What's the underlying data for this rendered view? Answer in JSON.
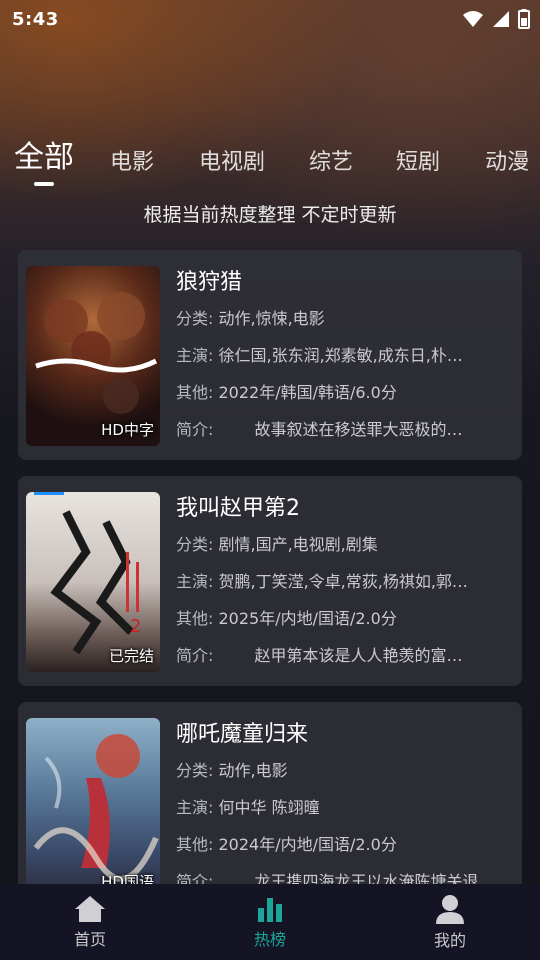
{
  "status_bar": {
    "time": "5:43"
  },
  "tabs": [
    {
      "label": "全部",
      "active": true
    },
    {
      "label": "电影",
      "active": false
    },
    {
      "label": "电视剧",
      "active": false
    },
    {
      "label": "综艺",
      "active": false
    },
    {
      "label": "短剧",
      "active": false
    },
    {
      "label": "动漫",
      "active": false
    }
  ],
  "subtitle": "根据当前热度整理 不定时更新",
  "field_labels": {
    "category": "分类: ",
    "cast": "主演: ",
    "other": "其他: ",
    "intro": "简介: "
  },
  "items": [
    {
      "title": "狼狩猎",
      "badge": "HD中字",
      "category": "动作,惊悚,电影",
      "cast": "徐仁国,张东润,郑素敏,成东日,朴…",
      "other": "2022年/韩国/韩语/6.0分",
      "intro": "故事叙述在移送罪大恶极的…"
    },
    {
      "title": "我叫赵甲第2",
      "badge": "已完结",
      "category": "剧情,国产,电视剧,剧集",
      "cast": "贺鹏,丁笑滢,令卓,常荻,杨祺如,郭…",
      "other": "2025年/内地/国语/2.0分",
      "intro": "赵甲第本该是人人艳羡的富…"
    },
    {
      "title": "哪吒魔童归来",
      "badge": "HD国语",
      "category": "动作,电影",
      "cast": "何中华 陈翊曈",
      "other": "2024年/内地/国语/2.0分",
      "intro": "龙王携四海龙王以水淹陈塘关退…"
    }
  ],
  "bottom_nav": [
    {
      "label": "首页",
      "icon": "home-icon",
      "active": false
    },
    {
      "label": "热榜",
      "icon": "chart-icon",
      "active": true
    },
    {
      "label": "我的",
      "icon": "user-icon",
      "active": false
    }
  ],
  "colors": {
    "accent": "#1aa79a",
    "card_bg": "#303038",
    "nav_bg": "#141424"
  }
}
